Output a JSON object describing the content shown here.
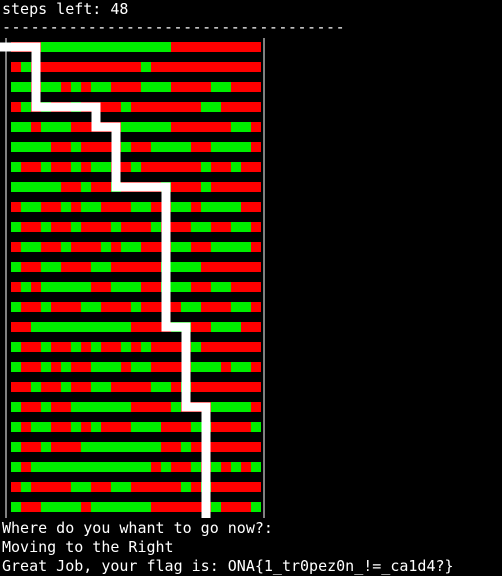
{
  "status": {
    "steps_left_text": "steps left: 48",
    "separator": "------------------------------------"
  },
  "board": {
    "rows": 23,
    "cols": 25,
    "colors": {
      "wall": "#ff0000",
      "open": "#00ee00",
      "path": "#ffffff",
      "player": "#0000ff",
      "frame": "#ffffff",
      "background": "#000000"
    },
    "green_segments": [
      [
        [
          3,
          15
        ]
      ],
      [
        [
          1,
          1
        ],
        [
          13,
          13
        ]
      ],
      [
        [
          0,
          1
        ],
        [
          3,
          4
        ],
        [
          6,
          6
        ],
        [
          8,
          9
        ],
        [
          13,
          15
        ],
        [
          20,
          21
        ]
      ],
      [
        [
          1,
          1
        ],
        [
          3,
          3
        ],
        [
          6,
          6
        ],
        [
          11,
          11
        ],
        [
          19,
          20
        ]
      ],
      [
        [
          0,
          1
        ],
        [
          3,
          5
        ],
        [
          11,
          15
        ],
        [
          22,
          23
        ]
      ],
      [
        [
          0,
          3
        ],
        [
          6,
          6
        ],
        [
          11,
          11
        ],
        [
          14,
          17
        ],
        [
          20,
          23
        ]
      ],
      [
        [
          0,
          0
        ],
        [
          3,
          3
        ],
        [
          6,
          6
        ],
        [
          8,
          9
        ],
        [
          12,
          12
        ],
        [
          19,
          19
        ],
        [
          22,
          22
        ]
      ],
      [
        [
          0,
          4
        ],
        [
          7,
          7
        ],
        [
          10,
          10
        ],
        [
          15,
          15
        ],
        [
          19,
          19
        ]
      ],
      [
        [
          1,
          2
        ],
        [
          5,
          5
        ],
        [
          7,
          8
        ],
        [
          12,
          13
        ],
        [
          16,
          17
        ],
        [
          19,
          22
        ]
      ],
      [
        [
          0,
          0
        ],
        [
          3,
          3
        ],
        [
          6,
          6
        ],
        [
          10,
          10
        ],
        [
          14,
          14
        ],
        [
          18,
          19
        ],
        [
          22,
          23
        ]
      ],
      [
        [
          1,
          2
        ],
        [
          5,
          5
        ],
        [
          9,
          9
        ],
        [
          11,
          12
        ],
        [
          16,
          17
        ],
        [
          20,
          23
        ]
      ],
      [
        [
          0,
          0
        ],
        [
          3,
          4
        ],
        [
          8,
          9
        ],
        [
          15,
          18
        ]
      ],
      [
        [
          1,
          1
        ],
        [
          3,
          7
        ],
        [
          10,
          12
        ],
        [
          15,
          17
        ],
        [
          20,
          21
        ]
      ],
      [
        [
          0,
          0
        ],
        [
          3,
          3
        ],
        [
          7,
          8
        ],
        [
          12,
          12
        ],
        [
          17,
          18
        ],
        [
          22,
          23
        ]
      ],
      [
        [
          2,
          11
        ],
        [
          16,
          17
        ],
        [
          20,
          22
        ]
      ],
      [
        [
          0,
          0
        ],
        [
          3,
          3
        ],
        [
          6,
          6
        ],
        [
          8,
          8
        ],
        [
          11,
          11
        ],
        [
          13,
          13
        ],
        [
          18,
          18
        ]
      ],
      [
        [
          0,
          0
        ],
        [
          3,
          3
        ],
        [
          5,
          5
        ],
        [
          8,
          10
        ],
        [
          12,
          13
        ],
        [
          18,
          20
        ],
        [
          22,
          23
        ]
      ],
      [
        [
          2,
          2
        ],
        [
          5,
          5
        ],
        [
          8,
          9
        ],
        [
          14,
          15
        ],
        [
          17,
          17
        ]
      ],
      [
        [
          0,
          0
        ],
        [
          3,
          3
        ],
        [
          6,
          11
        ],
        [
          16,
          16
        ],
        [
          20,
          23
        ]
      ],
      [
        [
          0,
          0
        ],
        [
          2,
          3
        ],
        [
          6,
          6
        ],
        [
          8,
          8
        ],
        [
          12,
          14
        ],
        [
          18,
          19
        ],
        [
          24,
          24
        ]
      ],
      [
        [
          0,
          0
        ],
        [
          3,
          3
        ],
        [
          7,
          14
        ],
        [
          17,
          17
        ]
      ],
      [
        [
          0,
          0
        ],
        [
          2,
          13
        ],
        [
          15,
          15
        ],
        [
          18,
          18
        ],
        [
          20,
          20
        ],
        [
          22,
          22
        ],
        [
          24,
          24
        ]
      ],
      [
        [
          1,
          1
        ],
        [
          6,
          7
        ],
        [
          10,
          11
        ],
        [
          17,
          17
        ],
        [
          19,
          19
        ]
      ],
      [
        [
          0,
          0
        ],
        [
          3,
          6
        ],
        [
          8,
          13
        ],
        [
          20,
          20
        ],
        [
          24,
          24
        ]
      ],
      [
        [
          0,
          0
        ],
        [
          2,
          15
        ],
        [
          19,
          19
        ],
        [
          22,
          22
        ]
      ]
    ],
    "player": {
      "row": 24,
      "col": 24
    },
    "path": [
      [
        0,
        0
      ],
      [
        0,
        2
      ],
      [
        3,
        2
      ],
      [
        3,
        8
      ],
      [
        4,
        8
      ],
      [
        4,
        10
      ],
      [
        7,
        10
      ],
      [
        7,
        15
      ],
      [
        14,
        15
      ],
      [
        14,
        17
      ],
      [
        18,
        17
      ],
      [
        18,
        19
      ],
      [
        24,
        19
      ],
      [
        24,
        23
      ]
    ]
  },
  "messages": {
    "prompt": "Where do you whant to go now?:",
    "move": "Moving to the Right",
    "result": "Great Job, your flag is: ONA{1_tr0pez0n_!=_ca1d4?}"
  }
}
